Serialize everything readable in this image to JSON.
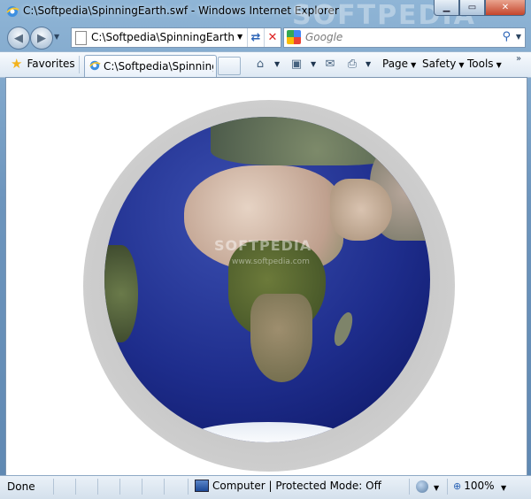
{
  "window": {
    "title": "C:\\Softpedia\\SpinningEarth.swf - Windows Internet Explorer",
    "watermark": "SOFTPEDIA"
  },
  "address": {
    "value": "C:\\Softpedia\\SpinningEarth.swf"
  },
  "search": {
    "placeholder": "Google"
  },
  "command_bar": {
    "favorites_label": "Favorites",
    "tab_label": "C:\\Softpedia\\SpinningE...",
    "page_menu": "Page",
    "safety_menu": "Safety",
    "tools_menu": "Tools"
  },
  "content": {
    "watermark_text": "SOFTPEDIA",
    "watermark_sub": "www.softpedia.com"
  },
  "status": {
    "text": "Done",
    "zone": "Computer | Protected Mode: Off",
    "zoom": "100%"
  },
  "colors": {
    "frame": "#6d95bd",
    "close_button": "#c4452b",
    "ocean": "#1e2d8c"
  }
}
